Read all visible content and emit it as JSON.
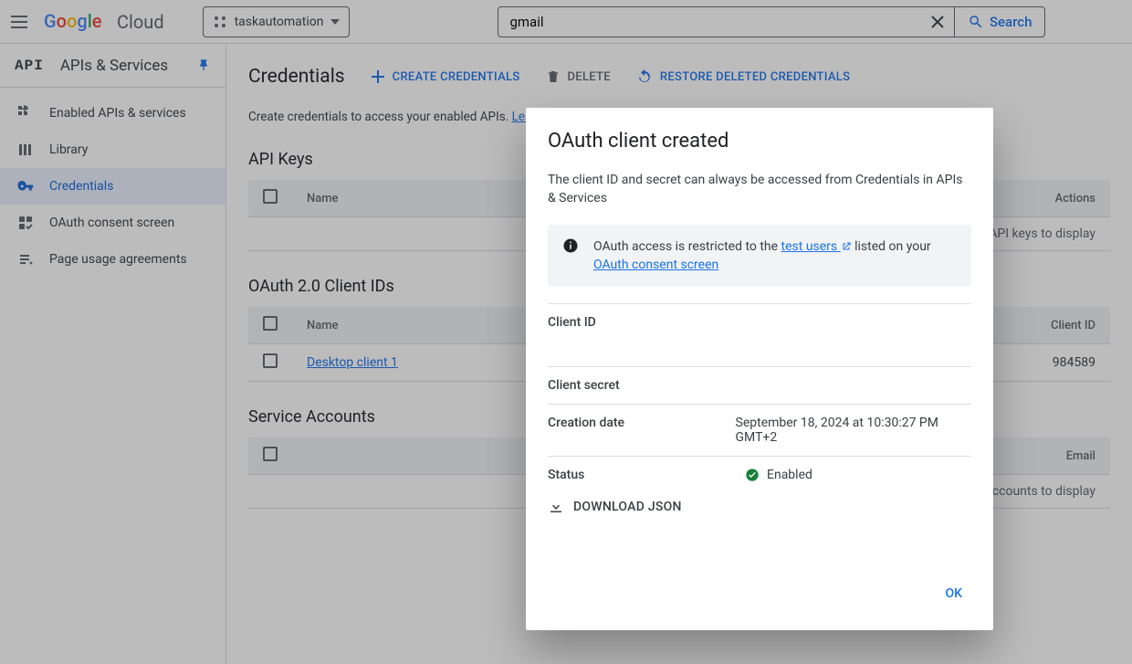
{
  "topbar": {
    "brand_cloud": "Cloud",
    "project_name": "taskautomation",
    "search_value": "gmail",
    "search_button": "Search"
  },
  "sidebar": {
    "api_mark": "API",
    "title": "APIs & Services",
    "items": [
      {
        "label": "Enabled APIs & services"
      },
      {
        "label": "Library"
      },
      {
        "label": "Credentials"
      },
      {
        "label": "OAuth consent screen"
      },
      {
        "label": "Page usage agreements"
      }
    ]
  },
  "main": {
    "title": "Credentials",
    "create_btn": "CREATE CREDENTIALS",
    "delete_btn": "DELETE",
    "restore_btn": "RESTORE DELETED CREDENTIALS",
    "desc_text": "Create credentials to access your enabled APIs. ",
    "desc_link": "Learn more",
    "api_keys_heading": "API Keys",
    "api_keys_cols": {
      "name": "Name",
      "actions": "Actions"
    },
    "api_keys_empty": "No API keys to display",
    "oauth_heading": "OAuth 2.0 Client IDs",
    "oauth_cols": {
      "name": "Name",
      "clientid": "Client ID"
    },
    "oauth_row": {
      "name": "Desktop client 1",
      "clientid": "984589"
    },
    "sa_heading": "Service Accounts",
    "sa_cols": {
      "email": "Email"
    },
    "sa_empty": "No service accounts to display"
  },
  "dialog": {
    "title": "OAuth client created",
    "subtitle": "The client ID and secret can always be accessed from Credentials in APIs & Services",
    "notice_pre": "OAuth access is restricted to the ",
    "notice_link1": "test users",
    "notice_mid": " listed on your ",
    "notice_link2": "OAuth consent screen",
    "client_id_label": "Client ID",
    "client_secret_label": "Client secret",
    "creation_date_label": "Creation date",
    "creation_date_value": "September 18, 2024 at 10:30:27 PM GMT+2",
    "status_label": "Status",
    "status_value": "Enabled",
    "download": "DOWNLOAD JSON",
    "ok": "OK"
  }
}
